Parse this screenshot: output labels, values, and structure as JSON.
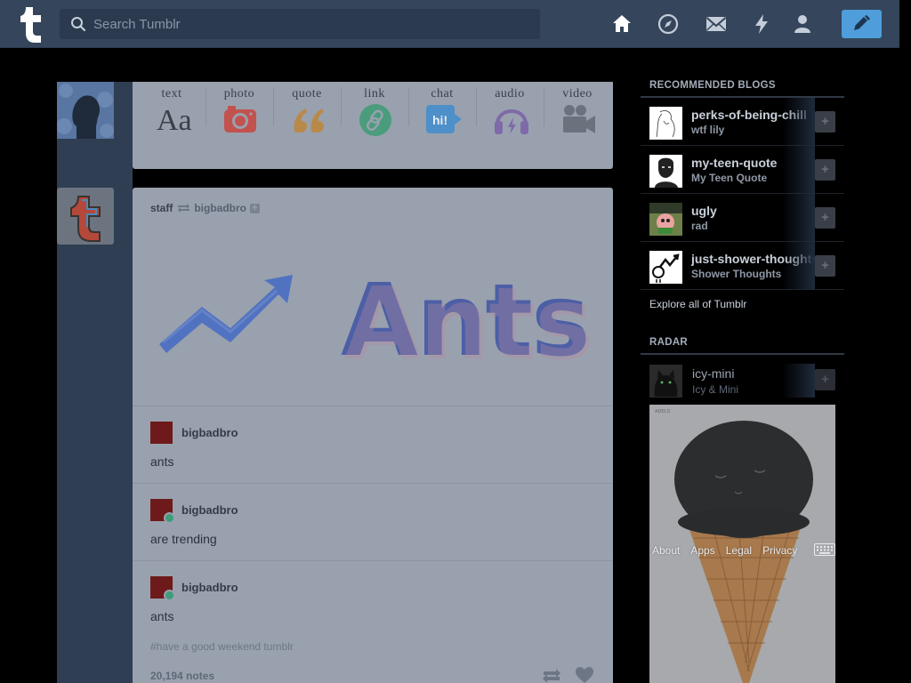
{
  "header": {
    "search_placeholder": "Search Tumblr",
    "nav": [
      "home-icon",
      "explore-icon",
      "inbox-icon",
      "activity-icon",
      "account-icon"
    ],
    "compose_icon": "pencil-icon"
  },
  "composer": {
    "types": [
      {
        "label": "text",
        "icon": "text-icon",
        "color": "#3a3f48"
      },
      {
        "label": "photo",
        "icon": "camera-icon",
        "color": "#c2524e"
      },
      {
        "label": "quote",
        "icon": "quote-icon",
        "color": "#b9894a"
      },
      {
        "label": "link",
        "icon": "link-icon",
        "color": "#4a9c7d"
      },
      {
        "label": "chat",
        "icon": "chat-icon",
        "color": "#4d8fc9"
      },
      {
        "label": "audio",
        "icon": "headphones-icon",
        "color": "#7e6aa9"
      },
      {
        "label": "video",
        "icon": "video-camera-icon",
        "color": "#6a727e"
      }
    ]
  },
  "post": {
    "author": "staff",
    "reblogged_from": "bigbadbro",
    "hero_text": "Ants",
    "reblogs": [
      {
        "name": "bigbadbro",
        "text": "ants"
      },
      {
        "name": "bigbadbro",
        "text": "are trending"
      },
      {
        "name": "bigbadbro",
        "text": "ants"
      }
    ],
    "tags": "#have a good weekend tumblr",
    "notes": "20,194 notes"
  },
  "sidebar": {
    "recommended_title": "RECOMMENDED BLOGS",
    "blogs": [
      {
        "name": "perks-of-being-chill",
        "desc": "wtf lily"
      },
      {
        "name": "my-teen-quote",
        "desc": "My Teen Quote"
      },
      {
        "name": "ugly",
        "desc": "rad"
      },
      {
        "name": "just-shower-thoughts",
        "desc": "Shower Thoughts"
      }
    ],
    "follow_label": "+",
    "explore": "Explore all of Tumblr",
    "radar_title": "RADAR",
    "radar_blog": {
      "name": "icy-mini",
      "desc": "Icy & Mini"
    }
  },
  "footer": {
    "links": [
      "About",
      "Apps",
      "Legal",
      "Privacy"
    ]
  }
}
